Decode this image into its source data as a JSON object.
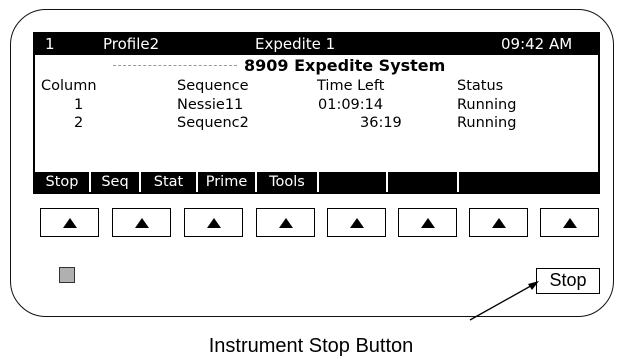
{
  "status_bar": {
    "column_no": "1",
    "profile": "Profile2",
    "mode": "Expedite 1",
    "time": "09:42 AM"
  },
  "system_title": "8909 Expedite System",
  "table": {
    "headers": [
      "Column",
      "Sequence",
      "Time Left",
      "Status"
    ],
    "rows": [
      [
        "1",
        "Nessie11",
        "01:09:14",
        "Running"
      ],
      [
        "2",
        "Sequenc2",
        "36:19",
        "Running"
      ]
    ]
  },
  "softkeys": [
    "Stop",
    "Seq",
    "Stat",
    "Prime",
    "Tools",
    "",
    "",
    ""
  ],
  "arrow_buttons": [
    "up-arrow-icon",
    "up-arrow-icon",
    "up-arrow-icon",
    "up-arrow-icon",
    "up-arrow-icon",
    "up-arrow-icon",
    "up-arrow-icon",
    "up-arrow-icon"
  ],
  "stop_button_label": "Stop",
  "callout_label": "Instrument Stop Button",
  "colors": {
    "lcd_bar": "#000000",
    "led": "#b0b0b0"
  }
}
